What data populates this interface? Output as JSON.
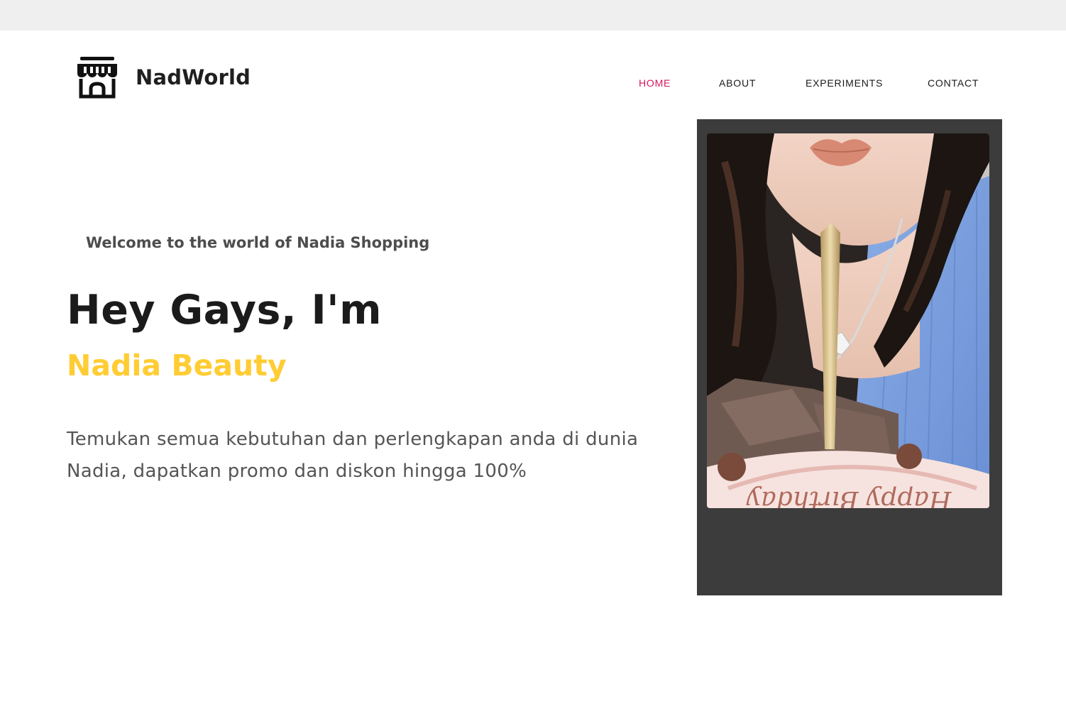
{
  "brand": {
    "name": "NadWorld",
    "icon": "storefront-icon"
  },
  "nav": [
    {
      "label": "HOME",
      "active": true
    },
    {
      "label": "ABOUT",
      "active": false
    },
    {
      "label": "EXPERIMENTS",
      "active": false
    },
    {
      "label": "CONTACT",
      "active": false
    }
  ],
  "hero": {
    "welcome": "Welcome to the world of Nadia Shopping",
    "title": "Hey Gays, I'm",
    "name": "Nadia Beauty",
    "description": "Temukan semua kebutuhan dan perlengkapan anda di dunia Nadia, dapatkan promo dan diskon hingga 100%"
  },
  "photo": {
    "cake_text": "Happy Birthday"
  },
  "colors": {
    "accent_nav": "#d6145e",
    "name_highlight": "#ffcc33",
    "frame": "#3c3c3c",
    "top_strip": "#efefef"
  }
}
